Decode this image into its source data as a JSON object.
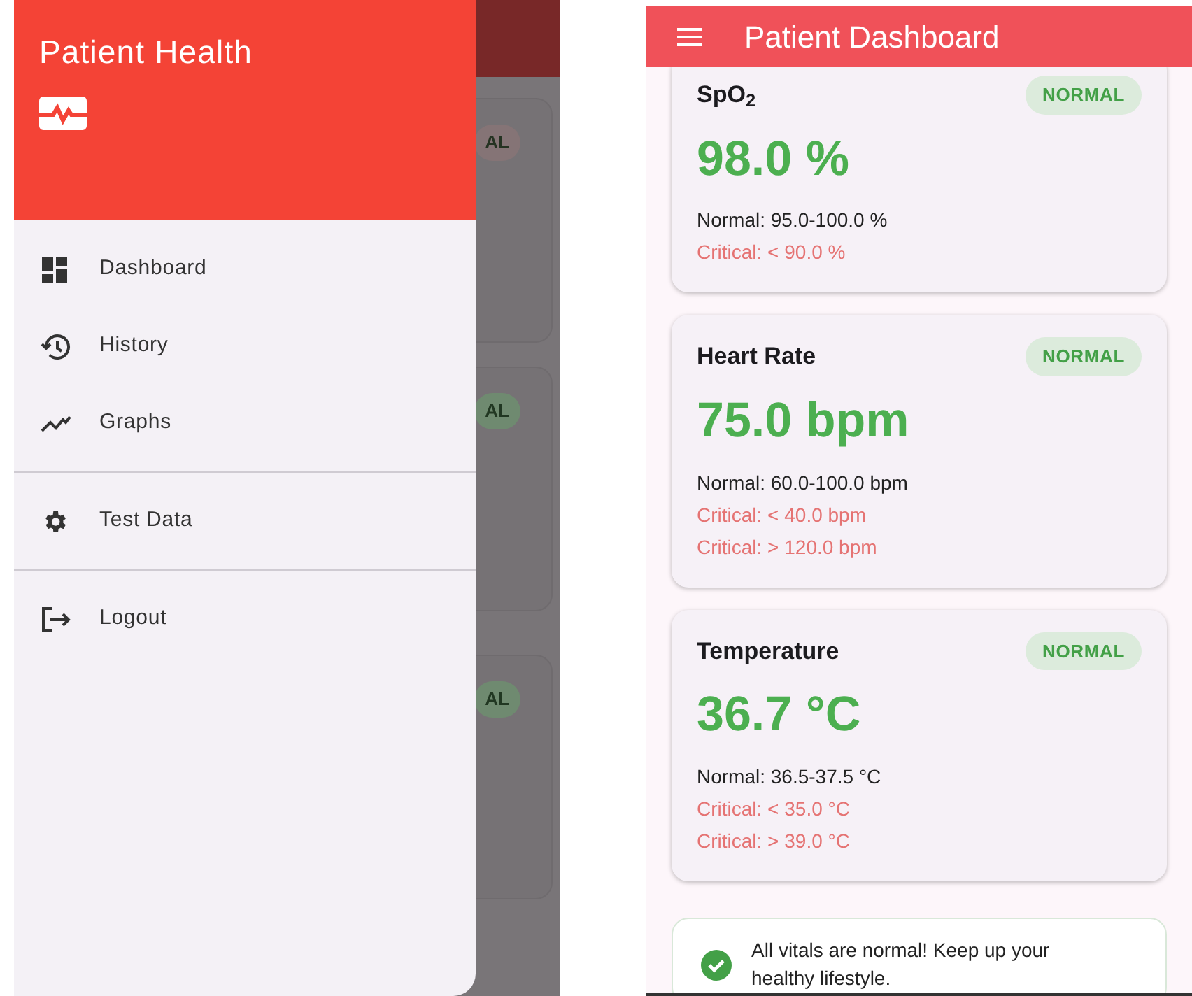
{
  "drawer": {
    "title": "Patient Health",
    "sections": [
      [
        {
          "label": "Dashboard"
        },
        {
          "label": "History"
        },
        {
          "label": "Graphs"
        }
      ],
      [
        {
          "label": "Test Data"
        }
      ],
      [
        {
          "label": "Logout"
        }
      ]
    ]
  },
  "background": {
    "badges": [
      {
        "text": "AL",
        "color": "#857476"
      },
      {
        "text": "AL",
        "color": "#6f8a70"
      },
      {
        "text": "AL",
        "color": "#6f8a70"
      }
    ]
  },
  "app_bar": {
    "title": "Patient Dashboard"
  },
  "vitals": [
    {
      "name": "SpO$_{2}$",
      "status": "NORMAL",
      "value": "98.0 %",
      "normal": "Normal: 95.0-100.0 %",
      "critical": [
        "Critical: < 90.0 %"
      ]
    },
    {
      "name": "Heart Rate",
      "status": "NORMAL",
      "value": "75.0 bpm",
      "normal": "Normal: 60.0-100.0 bpm",
      "critical": [
        "Critical: < 40.0 bpm",
        "Critical: > 120.0 bpm"
      ]
    },
    {
      "name": "Temperature",
      "status": "NORMAL",
      "value": "36.7 °C",
      "normal": "Normal: 36.5-37.5 °C",
      "critical": [
        "Critical: < 35.0 °C",
        "Critical: > 39.0 °C"
      ]
    }
  ],
  "summary": {
    "message": "All vitals are normal! Keep up your healthy lifestyle."
  }
}
